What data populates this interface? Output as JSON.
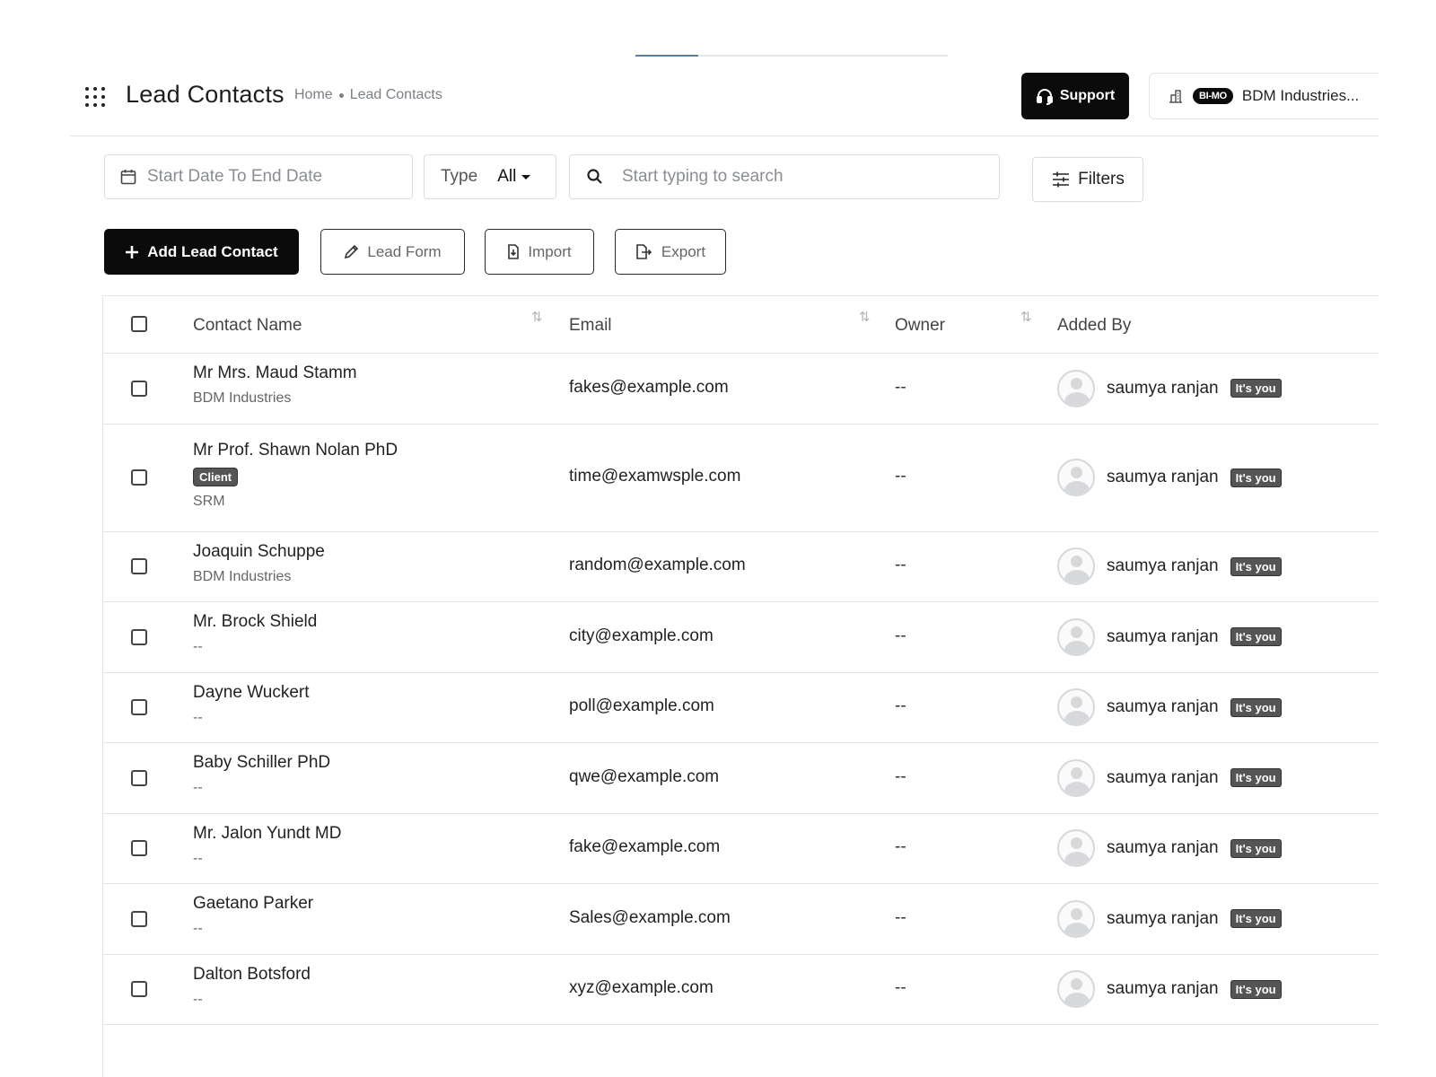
{
  "header": {
    "title": "Lead Contacts",
    "breadcrumb": [
      "Home",
      "Lead Contacts"
    ],
    "support_label": "Support",
    "company_badge": "BI-MO",
    "company_name": "BDM Industries..."
  },
  "filters": {
    "date_placeholder": "Start Date To End Date",
    "type_label": "Type",
    "type_value": "All",
    "search_placeholder": "Start typing to search",
    "filters_label": "Filters"
  },
  "actions": {
    "add_label": "Add Lead Contact",
    "lead_form_label": "Lead Form",
    "import_label": "Import",
    "export_label": "Export"
  },
  "table": {
    "columns": [
      "Contact Name",
      "Email",
      "Owner",
      "Added By"
    ],
    "rows": [
      {
        "name": "Mr Mrs. Maud Stamm",
        "company": "BDM Industries",
        "badge": "",
        "email": "fakes@example.com",
        "owner": "--",
        "added_by": "saumya ranjan",
        "you": "It's you"
      },
      {
        "name": "Mr Prof. Shawn Nolan PhD",
        "company": "SRM",
        "badge": "Client",
        "email": "time@examwsple.com",
        "owner": "--",
        "added_by": "saumya ranjan",
        "you": "It's you"
      },
      {
        "name": "Joaquin Schuppe",
        "company": "BDM Industries",
        "badge": "",
        "email": "random@example.com",
        "owner": "--",
        "added_by": "saumya ranjan",
        "you": "It's you"
      },
      {
        "name": "Mr. Brock Shield",
        "company": "--",
        "badge": "",
        "email": "city@example.com",
        "owner": "--",
        "added_by": "saumya ranjan",
        "you": "It's you"
      },
      {
        "name": "Dayne Wuckert",
        "company": "--",
        "badge": "",
        "email": "poll@example.com",
        "owner": "--",
        "added_by": "saumya ranjan",
        "you": "It's you"
      },
      {
        "name": "Baby Schiller PhD",
        "company": "--",
        "badge": "",
        "email": "qwe@example.com",
        "owner": "--",
        "added_by": "saumya ranjan",
        "you": "It's you"
      },
      {
        "name": "Mr. Jalon Yundt MD",
        "company": "--",
        "badge": "",
        "email": "fake@example.com",
        "owner": "--",
        "added_by": "saumya ranjan",
        "you": "It's you"
      },
      {
        "name": "Gaetano Parker",
        "company": "--",
        "badge": "",
        "email": "Sales@example.com",
        "owner": "--",
        "added_by": "saumya ranjan",
        "you": "It's you"
      },
      {
        "name": "Dalton Botsford",
        "company": "--",
        "badge": "",
        "email": "xyz@example.com",
        "owner": "--",
        "added_by": "saumya ranjan",
        "you": "It's you"
      }
    ]
  }
}
